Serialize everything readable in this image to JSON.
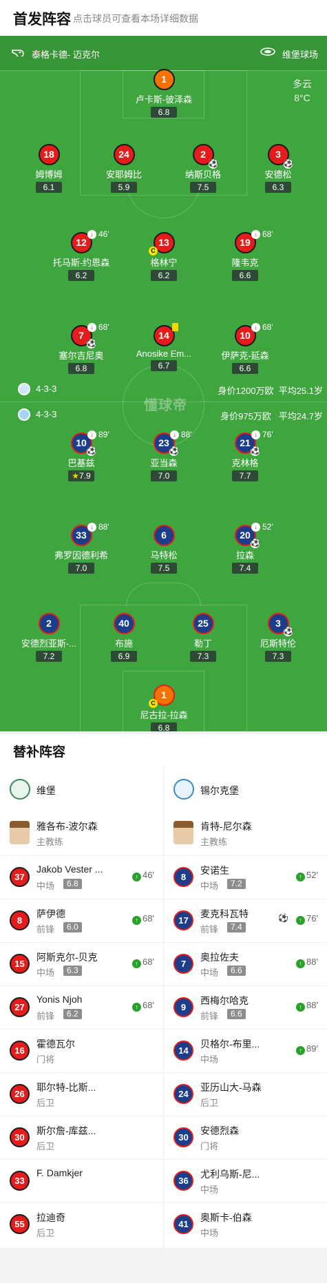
{
  "header": {
    "title": "首发阵容",
    "subtitle": "点击球员可查看本场详细数据"
  },
  "match": {
    "referee": "泰格卡德- 迈克尔",
    "stadium": "维堡球场",
    "weather": "多云",
    "temperature": "8°C",
    "watermark": "懂球帝"
  },
  "home_team": {
    "formation": "4-3-3",
    "value": "身价1200万欧",
    "avg_age": "平均25.1岁",
    "players": [
      {
        "num": "1",
        "name": "卢卡斯-彼泽森",
        "rating": "6.8"
      },
      {
        "num": "18",
        "name": "姆博姆",
        "rating": "6.1"
      },
      {
        "num": "24",
        "name": "安耶姆比",
        "rating": "5.9"
      },
      {
        "num": "2",
        "name": "纳斯贝格",
        "rating": "7.5"
      },
      {
        "num": "3",
        "name": "安德松",
        "rating": "6.3"
      },
      {
        "num": "12",
        "name": "托马斯-约恩森",
        "rating": "6.2",
        "sub": "46'"
      },
      {
        "num": "13",
        "name": "格林宁",
        "rating": "6.2"
      },
      {
        "num": "19",
        "name": "隆韦克",
        "rating": "6.6",
        "sub": "68'"
      },
      {
        "num": "7",
        "name": "塞尔吉尼奥",
        "rating": "6.8",
        "sub": "68'"
      },
      {
        "num": "14",
        "name": "Anosike Em...",
        "rating": "6.7"
      },
      {
        "num": "10",
        "name": "伊萨克-延森",
        "rating": "6.6",
        "sub": "68'"
      }
    ]
  },
  "away_team": {
    "formation": "4-3-3",
    "value": "身价975万欧",
    "avg_age": "平均24.7岁",
    "players": [
      {
        "num": "10",
        "name": "巴基兹",
        "rating": "7.9",
        "sub": "89'"
      },
      {
        "num": "23",
        "name": "亚当森",
        "rating": "7.0",
        "sub": "88'"
      },
      {
        "num": "21",
        "name": "克林格",
        "rating": "7.7",
        "sub": "76'"
      },
      {
        "num": "33",
        "name": "弗罗因德利希",
        "rating": "7.0",
        "sub": "88'"
      },
      {
        "num": "6",
        "name": "马特松",
        "rating": "7.5"
      },
      {
        "num": "20",
        "name": "拉森",
        "rating": "7.4",
        "sub": "52'"
      },
      {
        "num": "2",
        "name": "安德烈亚斯-...",
        "rating": "7.2"
      },
      {
        "num": "40",
        "name": "布施",
        "rating": "6.9"
      },
      {
        "num": "25",
        "name": "勒丁",
        "rating": "7.3"
      },
      {
        "num": "3",
        "name": "厄斯特伦",
        "rating": "7.3"
      },
      {
        "num": "1",
        "name": "尼古拉-拉森",
        "rating": "6.8"
      }
    ]
  },
  "subs": {
    "title": "替补阵容",
    "home": {
      "team": "维堡",
      "coach": {
        "name": "雅各布-波尔森",
        "role": "主教练"
      },
      "players": [
        {
          "num": "37",
          "name": "Jakob Vester ...",
          "pos": "中场",
          "rating": "6.8",
          "in": "46'"
        },
        {
          "num": "8",
          "name": "萨伊德",
          "pos": "前锋",
          "rating": "6.0",
          "in": "68'"
        },
        {
          "num": "15",
          "name": "阿斯克尔-贝克",
          "pos": "中场",
          "rating": "6.3",
          "in": "68'"
        },
        {
          "num": "27",
          "name": "Yonis Njoh",
          "pos": "前锋",
          "rating": "6.2",
          "in": "68'"
        },
        {
          "num": "16",
          "name": "霍德瓦尔",
          "pos": "门将"
        },
        {
          "num": "26",
          "name": "耶尔特-比斯...",
          "pos": "后卫"
        },
        {
          "num": "30",
          "name": "斯尔詹-库兹...",
          "pos": "后卫"
        },
        {
          "num": "33",
          "name": "F. Damkjer",
          "pos": ""
        },
        {
          "num": "55",
          "name": "拉迪奇",
          "pos": "后卫"
        }
      ]
    },
    "away": {
      "team": "锡尔克堡",
      "coach": {
        "name": "肯特-尼尔森",
        "role": "主教练"
      },
      "players": [
        {
          "num": "8",
          "name": "安诺生",
          "pos": "中场",
          "rating": "7.2",
          "in": "52'"
        },
        {
          "num": "17",
          "name": "麦克科瓦特",
          "pos": "前锋",
          "rating": "7.4",
          "in": "76'"
        },
        {
          "num": "7",
          "name": "奥拉佐夫",
          "pos": "中场",
          "rating": "6.6",
          "in": "88'"
        },
        {
          "num": "9",
          "name": "西梅尔哈克",
          "pos": "前锋",
          "rating": "6.6",
          "in": "88'"
        },
        {
          "num": "14",
          "name": "贝格尔-布里...",
          "pos": "中场",
          "in": "89'"
        },
        {
          "num": "24",
          "name": "亚历山大-马森",
          "pos": "后卫"
        },
        {
          "num": "30",
          "name": "安德烈森",
          "pos": "门将"
        },
        {
          "num": "36",
          "name": "尤利乌斯-尼...",
          "pos": "中场"
        },
        {
          "num": "41",
          "name": "奥斯卡-伯森",
          "pos": "中场"
        }
      ]
    }
  }
}
